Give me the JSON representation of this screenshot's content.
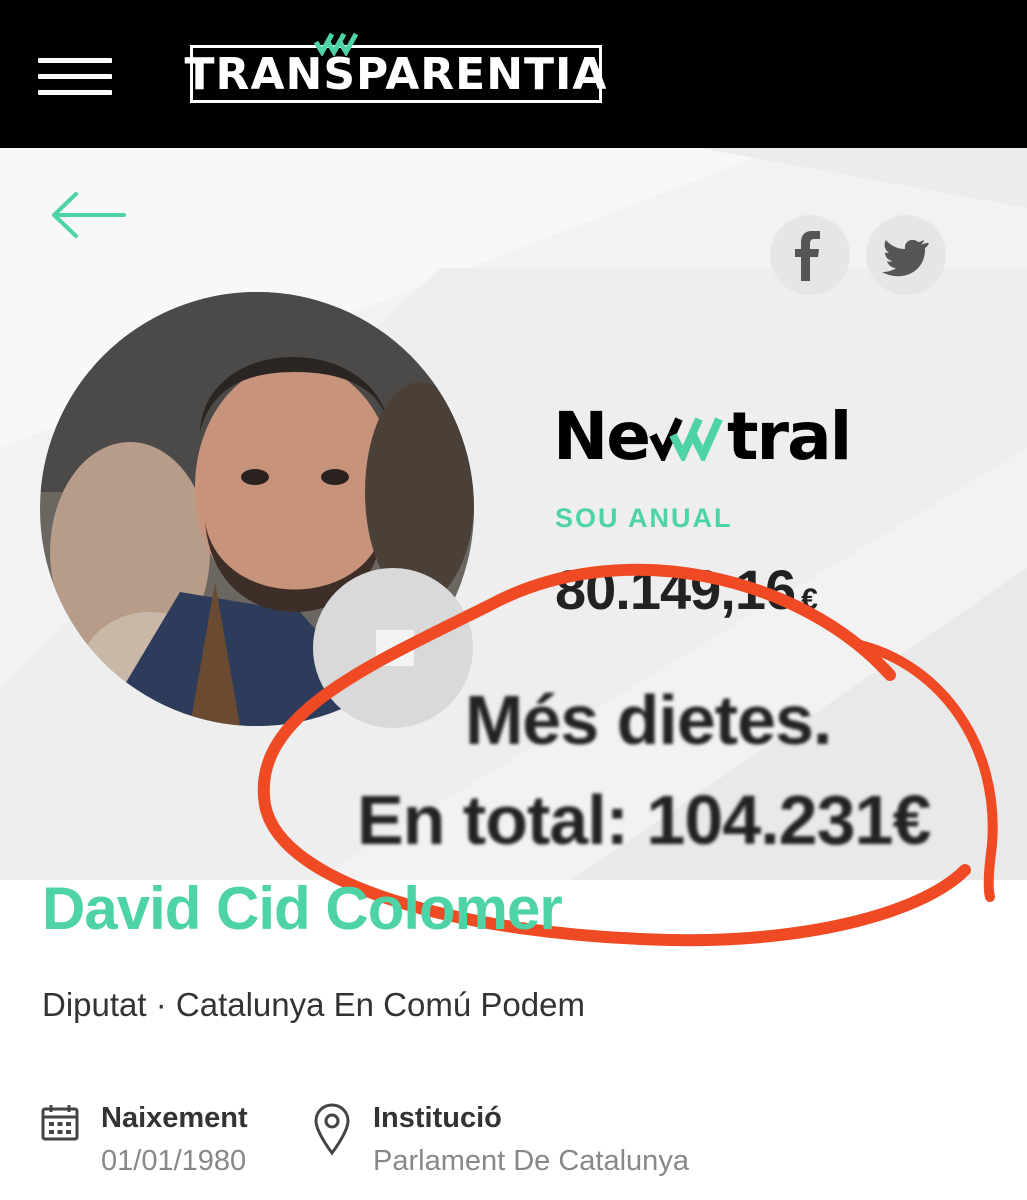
{
  "header": {
    "logo_text": "TRANSPARENTIA",
    "menu_icon": "hamburger-icon"
  },
  "nav": {
    "back_icon": "back-arrow-icon",
    "share": [
      "facebook-icon",
      "twitter-icon"
    ]
  },
  "profile": {
    "source_logo": {
      "prefix": "Ne",
      "suffix": "tral"
    },
    "salary_label": "SOU ANUAL",
    "salary_value": "80.149,16",
    "salary_currency": "€",
    "name": "David Cid Colomer",
    "role": "Diputat · Catalunya En Comú Podem"
  },
  "overlay": {
    "line1": "Més dietes.",
    "line2": "En total: 104.231€"
  },
  "details": {
    "birth_title": "Naixement",
    "birth_value": "01/01/1980",
    "institution_title": "Institució",
    "institution_value": "Parlament De Catalunya"
  },
  "colors": {
    "accent": "#4ed3a7",
    "annotation": "#f04a24",
    "header_bg": "#000000"
  }
}
